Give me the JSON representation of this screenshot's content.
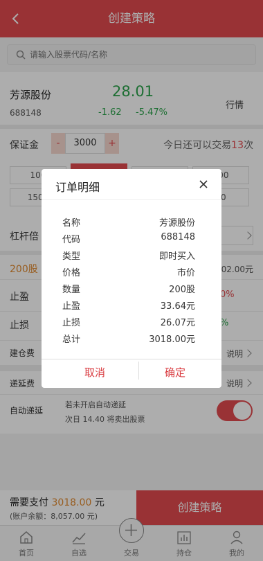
{
  "header": {
    "title": "创建策略"
  },
  "search": {
    "placeholder": "请输入股票代码/名称"
  },
  "stock": {
    "name": "芳源股份",
    "code": "688148",
    "price": "28.01",
    "change": "-1.62",
    "change_pct": "-5.47%",
    "quote_link": "行情"
  },
  "margin": {
    "label": "保证金",
    "minus": "-",
    "value": "3000",
    "plus": "+",
    "today_prefix": "今日还可以交易",
    "today_count": "13",
    "today_suffix": "次"
  },
  "amount_options": [
    "100",
    "1500",
    "000",
    "00"
  ],
  "leverage": {
    "label": "杠杆倍"
  },
  "shares": {
    "value": "200股",
    "right": "302.00元"
  },
  "take_profit": {
    "label": "止盈",
    "right": "0%"
  },
  "stop_loss": {
    "label": "止损",
    "right": "%"
  },
  "open_fee": {
    "label": "建仓费",
    "link": "说明"
  },
  "defer_fee": {
    "label": "递延费",
    "link": "说明"
  },
  "auto_defer": {
    "label": "自动递延",
    "line1": "若未开启自动递延",
    "line2": "次日 14.40 将卖出股票",
    "enabled": true
  },
  "footer": {
    "pay_label": "需要支付",
    "pay_amount": "3018.00",
    "pay_unit": "元",
    "balance": "(账户余额：8,057.00 元)",
    "create_button": "创建策略"
  },
  "tabbar": [
    {
      "label": "首页",
      "icon": "home-icon"
    },
    {
      "label": "自选",
      "icon": "trend-icon"
    },
    {
      "label": "交易",
      "icon": "plus-circle-icon"
    },
    {
      "label": "持仓",
      "icon": "bar-chart-icon"
    },
    {
      "label": "我的",
      "icon": "user-icon"
    }
  ],
  "dialog": {
    "title": "订单明细",
    "rows": [
      {
        "key": "名称",
        "value": "芳源股份"
      },
      {
        "key": "代码",
        "value": "688148"
      },
      {
        "key": "类型",
        "value": "即时买入"
      },
      {
        "key": "价格",
        "value": "市价"
      },
      {
        "key": "数量",
        "value": "200股"
      },
      {
        "key": "止盈",
        "value": "33.64元"
      },
      {
        "key": "止损",
        "value": "26.07元"
      },
      {
        "key": "总计",
        "value": "3018.00元"
      }
    ],
    "cancel": "取消",
    "confirm": "确定"
  },
  "colors": {
    "brand_red": "#e24a4f",
    "price_green": "#2aa34a",
    "pay_orange": "#e08a30"
  }
}
